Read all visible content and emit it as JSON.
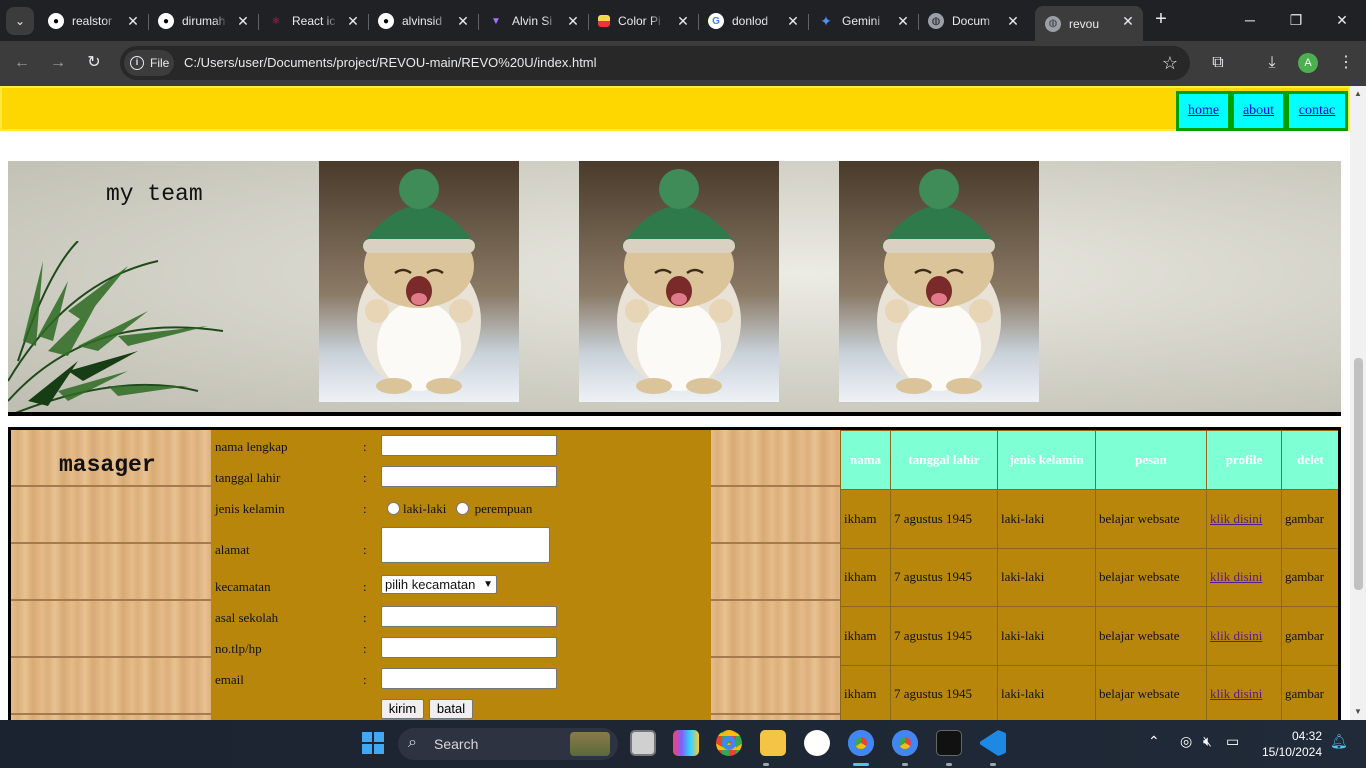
{
  "browser": {
    "tabs": [
      {
        "title": "realstor",
        "icon": "github-icon"
      },
      {
        "title": "dirumah",
        "icon": "github-icon"
      },
      {
        "title": "React ic",
        "icon": "react-icon"
      },
      {
        "title": "alvinsid",
        "icon": "github-icon"
      },
      {
        "title": "Alvin Si",
        "icon": "vite-icon"
      },
      {
        "title": "Color Pi",
        "icon": "color-picker-icon"
      },
      {
        "title": "donlod",
        "icon": "google-icon"
      },
      {
        "title": "Gemini",
        "icon": "gemini-icon"
      },
      {
        "title": "Docum",
        "icon": "globe-icon"
      },
      {
        "title": "revou",
        "icon": "globe-icon",
        "active": true
      }
    ],
    "chip_label": "File",
    "url": "C:/Users/user/Documents/project/REVOU-main/REVO%20U/index.html",
    "profile_initial": "A"
  },
  "page": {
    "nav": [
      "home",
      "about",
      "contac"
    ],
    "team_title": "my team",
    "messenger_title": "masager",
    "form": {
      "fields": [
        {
          "label": "nama lengkap",
          "colon": ":"
        },
        {
          "label": "tanggal lahir",
          "colon": ":"
        },
        {
          "label": "jenis kelamin",
          "colon": ":"
        },
        {
          "label": "alamat",
          "colon": ":"
        },
        {
          "label": "kecamatan",
          "colon": ":"
        },
        {
          "label": "asal sekolah",
          "colon": ":"
        },
        {
          "label": "no.tlp/hp",
          "colon": ":"
        },
        {
          "label": "email",
          "colon": ":"
        }
      ],
      "gender_options": [
        "laki-laki",
        "perempuan"
      ],
      "kecamatan_selected": "pilih kecamatan",
      "submit_label": "kirim",
      "cancel_label": "batal"
    },
    "table": {
      "headers": [
        "nama",
        "tanggal lahir",
        "jenis kelamin",
        "pesan",
        "profile",
        "delet"
      ],
      "rows": [
        [
          "ikham",
          "7 agustus 1945",
          "laki-laki",
          "belajar websate",
          "klik disini",
          "gambar"
        ],
        [
          "ikham",
          "7 agustus 1945",
          "laki-laki",
          "belajar websate",
          "klik disini",
          "gambar"
        ],
        [
          "ikham",
          "7 agustus 1945",
          "laki-laki",
          "belajar websate",
          "klik disini",
          "gambar"
        ],
        [
          "ikham",
          "7 agustus 1945",
          "laki-laki",
          "belajar websate",
          "klik disini",
          "gambar"
        ]
      ]
    }
  },
  "taskbar": {
    "search_label": "Search",
    "time": "04:32",
    "date": "15/10/2024"
  },
  "colors": {
    "header": "#ffd700",
    "nav_bg": "#00ffff",
    "form_bg": "#b8860b",
    "table_header": "#7fffd4"
  }
}
